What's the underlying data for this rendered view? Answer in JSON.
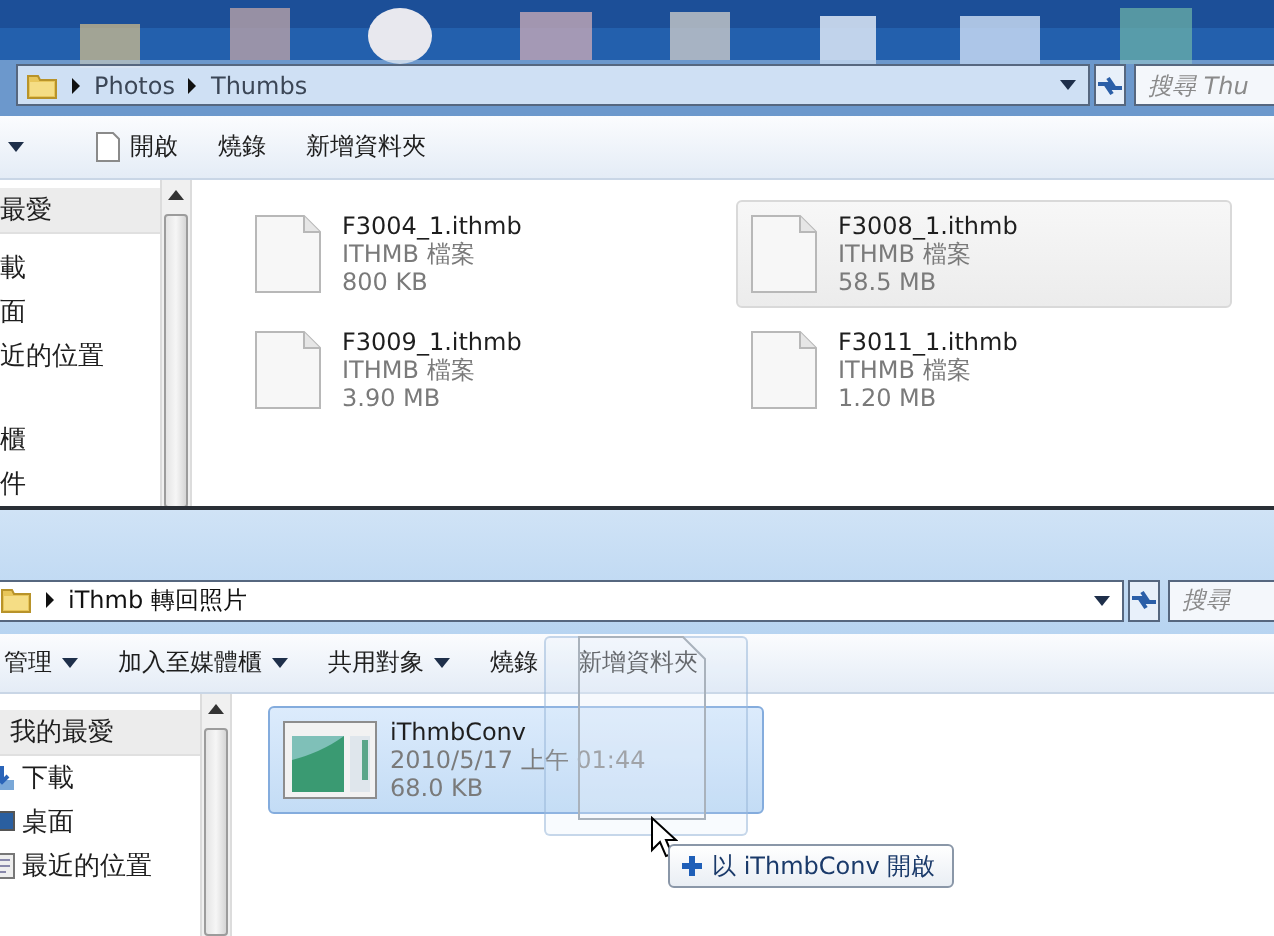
{
  "top_window": {
    "breadcrumb": [
      "Photos",
      "Thumbs"
    ],
    "search": {
      "placeholder": "搜尋 Thu"
    },
    "toolbar": [
      {
        "label": "開啟",
        "kind": "icon"
      },
      {
        "label": "燒錄",
        "kind": "plain"
      },
      {
        "label": "新增資料夾",
        "kind": "plain"
      }
    ],
    "sidebar": [
      {
        "items": [
          {
            "label": "最愛",
            "selected": true
          },
          {
            "label": "載",
            "selected": false
          },
          {
            "label": "面",
            "selected": false
          },
          {
            "label": "近的位置",
            "selected": false
          }
        ]
      },
      {
        "items": [
          {
            "label": "櫃",
            "selected": false
          },
          {
            "label": "件",
            "selected": false
          }
        ]
      }
    ],
    "files": [
      {
        "name": "F3004_1.ithmb",
        "detail": "ITHMB 檔案",
        "size": "800 KB",
        "kind": "document",
        "selected": false
      },
      {
        "name": "F3008_1.ithmb",
        "detail": "ITHMB 檔案",
        "size": "58.5 MB",
        "kind": "document",
        "selected": true
      },
      {
        "name": "F3009_1.ithmb",
        "detail": "ITHMB 檔案",
        "size": "3.90 MB",
        "kind": "document",
        "selected": false
      },
      {
        "name": "F3011_1.ithmb",
        "detail": "ITHMB 檔案",
        "size": "1.20 MB",
        "kind": "document",
        "selected": false
      }
    ]
  },
  "bottom_window": {
    "breadcrumb": [
      "iThmb 轉回照片"
    ],
    "search": {
      "placeholder": "搜尋"
    },
    "toolbar": [
      {
        "label": "管理",
        "kind": "dropdown"
      },
      {
        "label": "加入至媒體櫃",
        "kind": "dropdown"
      },
      {
        "label": "共用對象",
        "kind": "dropdown"
      },
      {
        "label": "燒錄",
        "kind": "plain"
      },
      {
        "label": "新增資料夾",
        "kind": "plain"
      }
    ],
    "sidebar": [
      {
        "items": [
          {
            "label": "我的最愛",
            "selected": true
          },
          {
            "label": "下載",
            "selected": false,
            "kind": "download"
          },
          {
            "label": "桌面",
            "selected": false,
            "kind": "desktop"
          },
          {
            "label": "最近的位置",
            "selected": false,
            "kind": "recent"
          }
        ]
      }
    ],
    "files": [
      {
        "name": "iThmbConv",
        "detail": "2010/5/17 上午 01:44",
        "size": "68.0 KB",
        "kind": "app",
        "selected": true
      }
    ]
  },
  "drag_tooltip": {
    "label": "以 iThmbConv 開啟"
  }
}
